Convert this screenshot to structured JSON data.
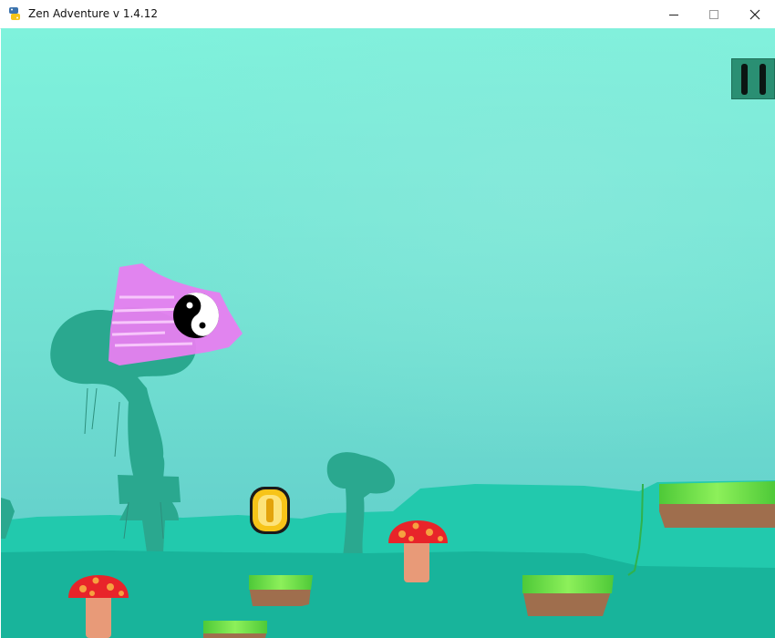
{
  "window": {
    "title": "Zen Adventure v 1.4.12",
    "app_icon": "python-logo-icon",
    "controls": [
      "minimize-icon",
      "maximize-icon",
      "close-icon"
    ]
  },
  "game": {
    "pause_icon": "pause-icon",
    "colors": {
      "sky_top": "#7ff2dc",
      "sky_bottom": "#5fcdc8",
      "hills": "#22c9ad",
      "ground": "#18b49b",
      "mushroom_cap": "#e8242a",
      "mushroom_stem": "#e89a78",
      "coin": "#f7c418",
      "player_aura": "#e77ef0",
      "grass": "#6fe04a",
      "dirt": "#9f6e4d"
    },
    "sprites": [
      "yin-yang-player",
      "gold-coin",
      "red-mushroom",
      "grass-platform",
      "tree-silhouette"
    ]
  }
}
